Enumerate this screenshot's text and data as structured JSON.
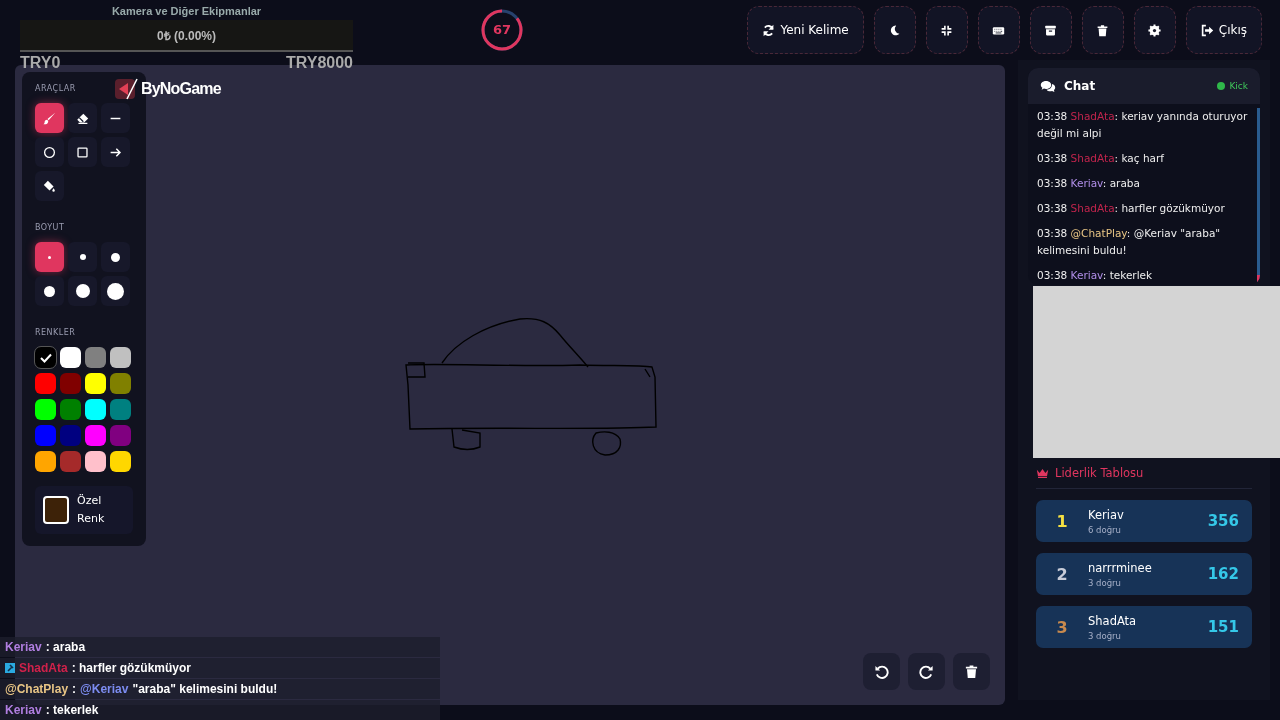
{
  "overlay": {
    "caption": "Kamera ve Diğer Ekipmanlar",
    "goal_amount": "0₺ (0.00%)",
    "goal_min": "TRY0",
    "goal_max": "TRY8000"
  },
  "timer": {
    "value": "67"
  },
  "top_buttons": [
    {
      "kind": "refresh",
      "label": "Yeni Kelime"
    },
    {
      "kind": "moon"
    },
    {
      "kind": "compress"
    },
    {
      "kind": "keyboard"
    },
    {
      "kind": "archive"
    },
    {
      "kind": "trash"
    },
    {
      "kind": "gear"
    },
    {
      "kind": "logout",
      "label": "Çıkış"
    }
  ],
  "logo": {
    "text": "ByNoGame"
  },
  "tools_title": "ARAÇLAR",
  "tools": [
    {
      "kind": "brush",
      "selected": true
    },
    {
      "kind": "eraser",
      "selected": false
    },
    {
      "kind": "line",
      "selected": false
    },
    {
      "kind": "circle",
      "selected": false
    },
    {
      "kind": "square",
      "selected": false
    },
    {
      "kind": "arrow",
      "selected": false
    },
    {
      "kind": "fill",
      "selected": false
    }
  ],
  "size_title": "BOYUT",
  "sizes": [
    {
      "selected": true
    },
    {
      "selected": false
    },
    {
      "selected": false
    },
    {
      "selected": false
    },
    {
      "selected": false
    },
    {
      "selected": false
    }
  ],
  "colors_title": "RENKLER",
  "colors": [
    {
      "color": "#000000",
      "selected": true
    },
    {
      "color": "#ffffff",
      "selected": false
    },
    {
      "color": "#808080",
      "selected": false
    },
    {
      "color": "#c0c0c0",
      "selected": false
    },
    {
      "color": "#ff0000",
      "selected": false
    },
    {
      "color": "#800000",
      "selected": false
    },
    {
      "color": "#ffff00",
      "selected": false
    },
    {
      "color": "#808000",
      "selected": false
    },
    {
      "color": "#00ff00",
      "selected": false
    },
    {
      "color": "#008000",
      "selected": false
    },
    {
      "color": "#00ffff",
      "selected": false
    },
    {
      "color": "#008080",
      "selected": false
    },
    {
      "color": "#0000ff",
      "selected": false
    },
    {
      "color": "#000080",
      "selected": false
    },
    {
      "color": "#ff00ff",
      "selected": false
    },
    {
      "color": "#800080",
      "selected": false
    },
    {
      "color": "#ffa500",
      "selected": false
    },
    {
      "color": "#a52a2a",
      "selected": false
    },
    {
      "color": "#ffc0cb",
      "selected": false
    },
    {
      "color": "#ffd700",
      "selected": false
    }
  ],
  "custom_color": {
    "color": "#3d2208",
    "label": "Özel Renk"
  },
  "canvas_buttons": [
    {
      "kind": "undo"
    },
    {
      "kind": "redo"
    },
    {
      "kind": "trash"
    }
  ],
  "stream_chat": [
    {
      "user": "Keriav",
      "color": "#b07ee0",
      "badge": false,
      "parts": [
        {
          "kind": "text",
          "text": ": araba"
        }
      ]
    },
    {
      "user": "ShadAta",
      "color": "#d0214a",
      "badge": true,
      "parts": [
        {
          "kind": "text",
          "text": ": harfler gözükmüyor"
        }
      ]
    },
    {
      "user": "@ChatPlay",
      "color": "#e8c585",
      "badge": false,
      "parts": [
        {
          "kind": "text",
          "text": ":"
        },
        {
          "kind": "mention",
          "text": "@Keriav"
        },
        {
          "kind": "text",
          "text": "\"araba\" kelimesini buldu!"
        }
      ]
    },
    {
      "user": "Keriav",
      "color": "#b07ee0",
      "badge": false,
      "parts": [
        {
          "kind": "text",
          "text": ": tekerlek"
        }
      ]
    }
  ],
  "chat": {
    "title": "Chat",
    "status": "Kick",
    "online": true,
    "messages": [
      {
        "time": "03:38",
        "user": "ShadAta",
        "color": "#c0244c",
        "text": ": keriav yanında oturuyor değil mi alpi"
      },
      {
        "time": "03:38",
        "user": "ShadAta",
        "color": "#c0244c",
        "text": ": kaç harf"
      },
      {
        "time": "03:38",
        "user": "Keriav",
        "color": "#b08ee8",
        "text": ": araba"
      },
      {
        "time": "03:38",
        "user": "ShadAta",
        "color": "#c0244c",
        "text": ": harfler gözükmüyor"
      },
      {
        "time": "03:38",
        "user": "@ChatPlay",
        "color": "#e8c585",
        "text": ": @Keriav \"araba\" kelimesini buldu!"
      },
      {
        "time": "03:38",
        "user": "Keriav",
        "color": "#b08ee8",
        "text": ": tekerlek"
      }
    ]
  },
  "leaderboard": {
    "title": "Liderlik Tablosu",
    "rows": [
      {
        "rank": "1",
        "name": "Keriav",
        "correct": "6 doğru",
        "score": "356",
        "color": "#f5e042"
      },
      {
        "rank": "2",
        "name": "narrrminee",
        "correct": "3 doğru",
        "score": "162",
        "color": "#c8ccd8"
      },
      {
        "rank": "3",
        "name": "ShadAta",
        "correct": "3 doğru",
        "score": "151",
        "color": "#c88a4e"
      }
    ]
  }
}
